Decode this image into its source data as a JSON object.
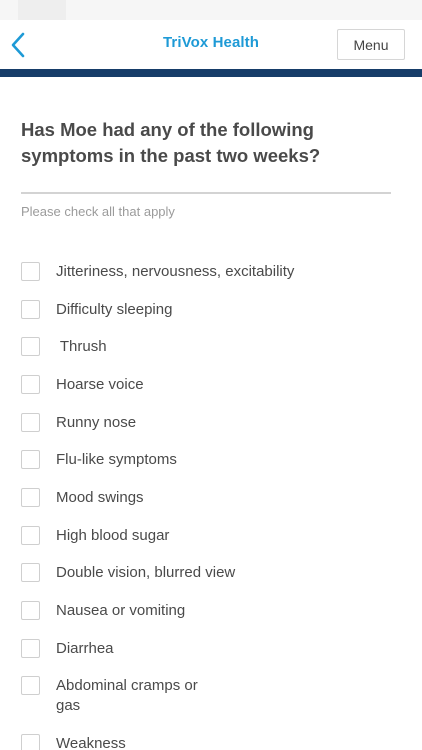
{
  "header": {
    "app_title": "TriVox Health",
    "menu_label": "Menu",
    "back_icon": "chevron-left-icon"
  },
  "colors": {
    "brand_blue": "#1e9ad6",
    "header_bar": "#163d69",
    "text": "#4a4a4a",
    "muted_text": "#9b9b9b",
    "checkbox_border": "#cfcfcf"
  },
  "question": {
    "title": "Has Moe had any of the following symptoms in the past two weeks?",
    "instruction": "Please check all that apply"
  },
  "options": [
    {
      "label": "Jitteriness, nervousness, excitability",
      "checked": false
    },
    {
      "label": "Difficulty sleeping",
      "checked": false
    },
    {
      "label": " Thrush",
      "checked": false
    },
    {
      "label": "Hoarse voice",
      "checked": false
    },
    {
      "label": "Runny nose",
      "checked": false
    },
    {
      "label": "Flu-like symptoms",
      "checked": false
    },
    {
      "label": "Mood swings",
      "checked": false
    },
    {
      "label": "High blood sugar",
      "checked": false
    },
    {
      "label": "Double vision, blurred view",
      "checked": false
    },
    {
      "label": "Nausea or vomiting",
      "checked": false
    },
    {
      "label": "Diarrhea",
      "checked": false
    },
    {
      "label": "Abdominal cramps or gas",
      "checked": false
    },
    {
      "label": "Weakness",
      "checked": false
    }
  ]
}
